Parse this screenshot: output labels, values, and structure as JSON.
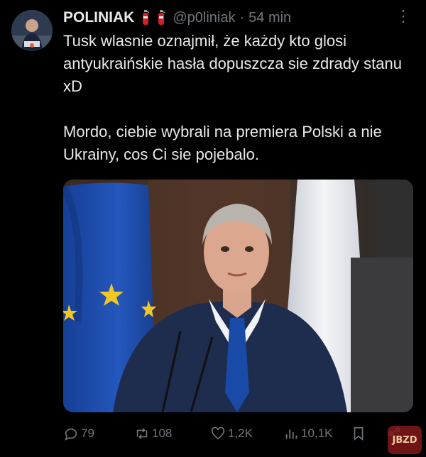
{
  "tweet": {
    "author_name": "POLINIAK",
    "handle": "@p0liniak",
    "separator": "·",
    "time": "54 min",
    "more_icon": "more-dots-icon",
    "text_paragraphs": [
      "Tusk wlasnie oznajmił, że każdy kto glosi antyukraińskie hasła dopuszcza sie zdrady stanu xD",
      "Mordo, ciebie wybrali na premiera Polski a nie Ukrainy, cos Ci sie pojebalo."
    ]
  },
  "actions": {
    "replies": "79",
    "reposts": "108",
    "likes": "1,2K",
    "views": "10,1K"
  },
  "watermark": {
    "text": "JBZD"
  },
  "colors": {
    "background": "#000000",
    "text": "#e7e9ea",
    "muted": "#71767b",
    "eu_blue": "#1d4fae",
    "eu_star": "#f3c623",
    "extinguisher_red": "#d0202a"
  }
}
